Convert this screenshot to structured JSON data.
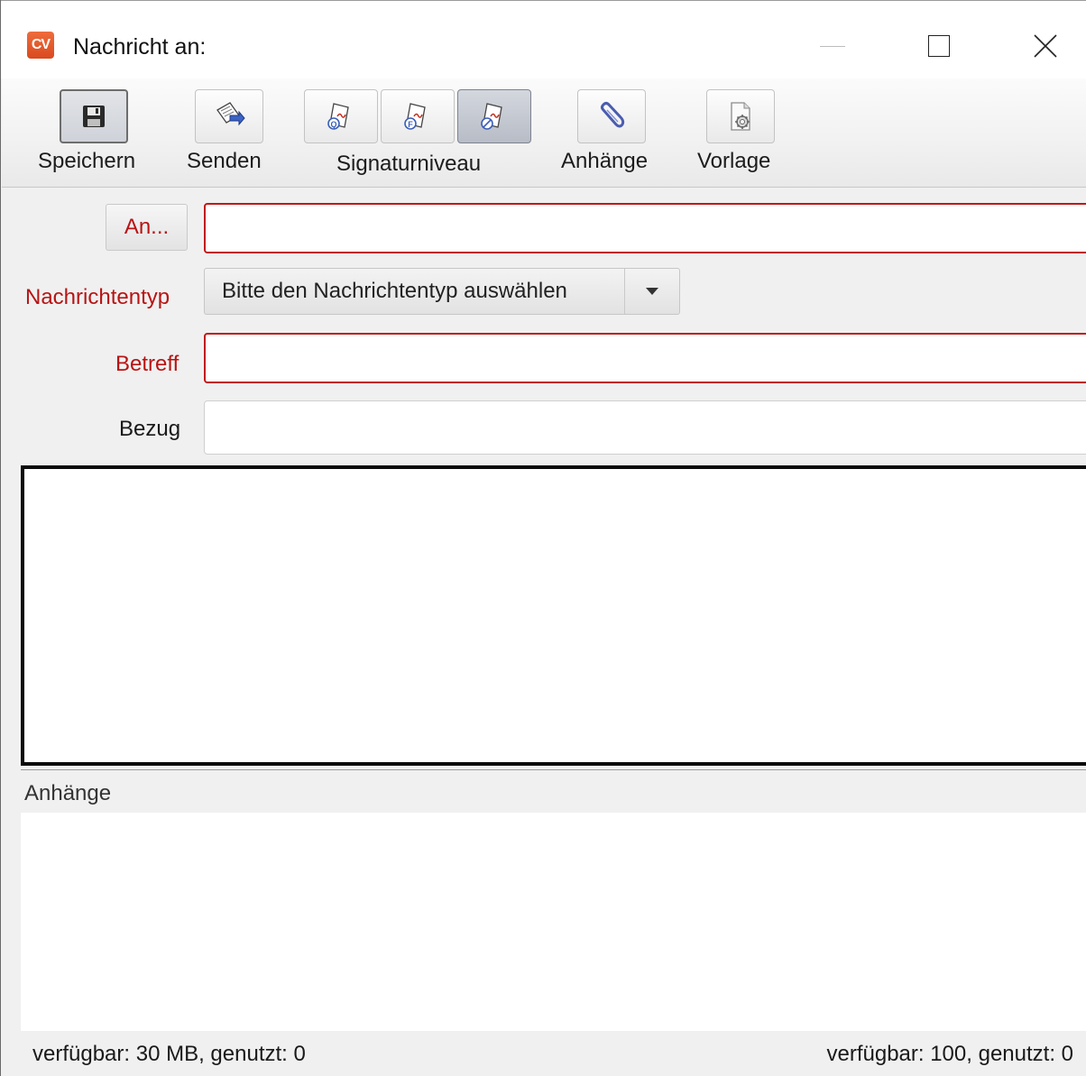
{
  "window": {
    "title": "Nachricht an:",
    "logo_text": "CV",
    "accent_color": "#e05a2a",
    "controls": [
      "minimize-icon",
      "maximize-icon",
      "close-icon"
    ]
  },
  "toolbar": {
    "save_label": "Speichern",
    "send_label": "Senden",
    "signature_label": "Signaturniveau",
    "signature_options": [
      {
        "icon": "signature-qualified-icon",
        "letter": "Q",
        "selected": false
      },
      {
        "icon": "signature-advanced-icon",
        "letter": "F",
        "selected": false
      },
      {
        "icon": "signature-none-icon",
        "letter": "⊘",
        "selected": true
      }
    ],
    "attachments_label": "Anhänge",
    "template_label": "Vorlage"
  },
  "form": {
    "to_button": "An...",
    "to_value": "",
    "message_type_label": "Nachrichtentyp",
    "message_type_value": "Bitte den Nachrichtentyp auswählen",
    "subject_label": "Betreff",
    "subject_value": "",
    "reference_label": "Bezug",
    "reference_value": "",
    "required_color": "#b81414"
  },
  "body_editor": {
    "content": ""
  },
  "attachments": {
    "label": "Anhänge",
    "items": []
  },
  "status": {
    "size_info": "verfügbar: 30 MB, genutzt: 0",
    "count_info": "verfügbar: 100, genutzt: 0"
  }
}
